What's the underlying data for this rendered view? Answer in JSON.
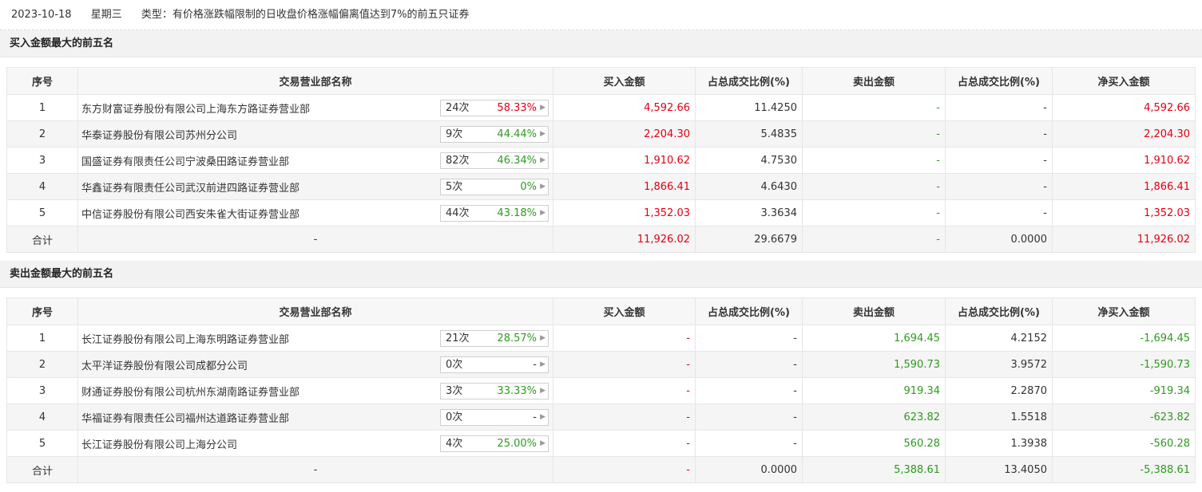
{
  "header": {
    "date": "2023-10-18",
    "weekday": "星期三",
    "type": "类型：有价格涨跌幅限制的日收盘价格涨幅偏离值达到7%的前五只证券"
  },
  "colors": {
    "red": "#e4000e",
    "green": "#2e9b1f"
  },
  "columns": [
    "序号",
    "交易营业部名称",
    "买入金额",
    "占总成交比例(%)",
    "卖出金额",
    "占总成交比例(%)",
    "净买入金额"
  ],
  "buy": {
    "title": "买入金额最大的前五名",
    "rows": [
      {
        "rank": "1",
        "name": "东方财富证券股份有限公司上海东方路证券营业部",
        "count": "24次",
        "pct": "58.33%",
        "pct_color": "red",
        "buy": "4,592.66",
        "buy_ratio": "11.4250",
        "sell": "-",
        "sell_ratio": "-",
        "net": "4,592.66"
      },
      {
        "rank": "2",
        "name": "华泰证券股份有限公司苏州分公司",
        "count": "9次",
        "pct": "44.44%",
        "pct_color": "green",
        "buy": "2,204.30",
        "buy_ratio": "5.4835",
        "sell": "-",
        "sell_ratio": "-",
        "net": "2,204.30"
      },
      {
        "rank": "3",
        "name": "国盛证券有限责任公司宁波桑田路证券营业部",
        "count": "82次",
        "pct": "46.34%",
        "pct_color": "green",
        "buy": "1,910.62",
        "buy_ratio": "4.7530",
        "sell": "-",
        "sell_ratio": "-",
        "net": "1,910.62"
      },
      {
        "rank": "4",
        "name": "华鑫证券有限责任公司武汉前进四路证券营业部",
        "count": "5次",
        "pct": "0%",
        "pct_color": "green",
        "buy": "1,866.41",
        "buy_ratio": "4.6430",
        "sell": "-",
        "sell_ratio": "-",
        "net": "1,866.41"
      },
      {
        "rank": "5",
        "name": "中信证券股份有限公司西安朱雀大街证券营业部",
        "count": "44次",
        "pct": "43.18%",
        "pct_color": "green",
        "buy": "1,352.03",
        "buy_ratio": "3.3634",
        "sell": "-",
        "sell_ratio": "-",
        "net": "1,352.03"
      }
    ],
    "total": {
      "label": "合计",
      "name": "-",
      "buy": "11,926.02",
      "buy_ratio": "29.6679",
      "sell": "-",
      "sell_ratio": "0.0000",
      "net": "11,926.02"
    }
  },
  "sell": {
    "title": "卖出金额最大的前五名",
    "rows": [
      {
        "rank": "1",
        "name": "长江证券股份有限公司上海东明路证券营业部",
        "count": "21次",
        "pct": "28.57%",
        "pct_color": "green",
        "buy": "-",
        "buy_ratio": "-",
        "sell": "1,694.45",
        "sell_ratio": "4.2152",
        "net": "-1,694.45"
      },
      {
        "rank": "2",
        "name": "太平洋证券股份有限公司成都分公司",
        "count": "0次",
        "pct": "-",
        "pct_color": "gray",
        "buy": "-",
        "buy_ratio": "-",
        "sell": "1,590.73",
        "sell_ratio": "3.9572",
        "net": "-1,590.73"
      },
      {
        "rank": "3",
        "name": "财通证券股份有限公司杭州东湖南路证券营业部",
        "count": "3次",
        "pct": "33.33%",
        "pct_color": "green",
        "buy": "-",
        "buy_ratio": "-",
        "sell": "919.34",
        "sell_ratio": "2.2870",
        "net": "-919.34"
      },
      {
        "rank": "4",
        "name": "华福证券有限责任公司福州达道路证券营业部",
        "count": "0次",
        "pct": "-",
        "pct_color": "gray",
        "buy": "-",
        "buy_ratio": "-",
        "sell": "623.82",
        "sell_ratio": "1.5518",
        "net": "-623.82"
      },
      {
        "rank": "5",
        "name": "长江证券股份有限公司上海分公司",
        "count": "4次",
        "pct": "25.00%",
        "pct_color": "green",
        "buy": "-",
        "buy_ratio": "-",
        "sell": "560.28",
        "sell_ratio": "1.3938",
        "net": "-560.28"
      }
    ],
    "total": {
      "label": "合计",
      "name": "-",
      "buy": "-",
      "buy_ratio": "0.0000",
      "sell": "5,388.61",
      "sell_ratio": "13.4050",
      "net": "-5,388.61"
    }
  }
}
